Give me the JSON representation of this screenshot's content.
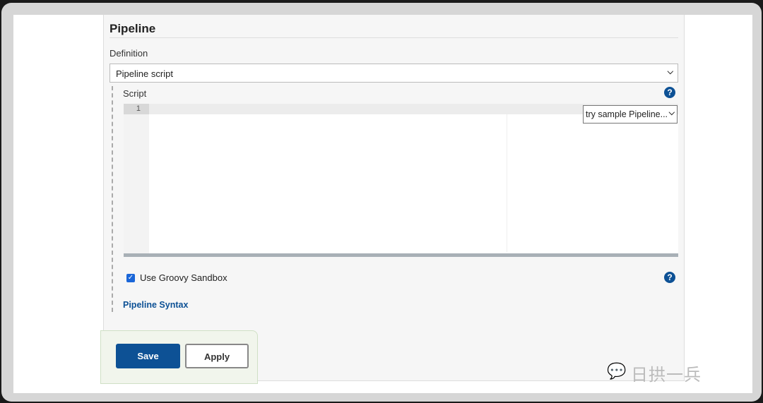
{
  "section": {
    "title": "Pipeline"
  },
  "definition": {
    "label": "Definition",
    "selected": "Pipeline script"
  },
  "script": {
    "label": "Script",
    "line_numbers": [
      "1"
    ],
    "content": "",
    "sample_select": "try sample Pipeline..."
  },
  "sandbox": {
    "label": "Use Groovy Sandbox",
    "checked": true
  },
  "links": {
    "pipeline_syntax": "Pipeline Syntax"
  },
  "buttons": {
    "save": "Save",
    "apply": "Apply"
  },
  "help_icon": "?",
  "watermark": "日拱一兵",
  "colors": {
    "primary": "#0d5195",
    "checkbox": "#1a66d8"
  }
}
